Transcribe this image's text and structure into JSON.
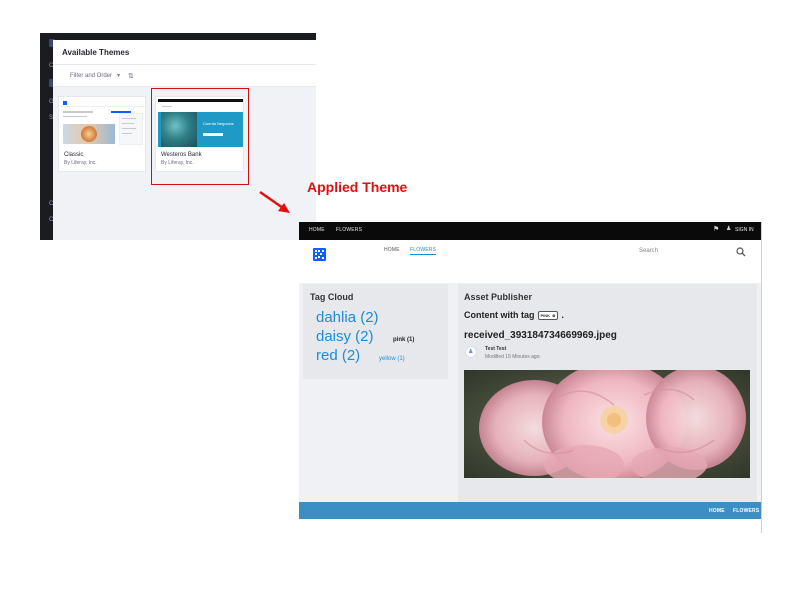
{
  "themes_panel": {
    "title": "Available Themes",
    "filter_label": "Filter and Order",
    "left_glyphs": [
      "C",
      "G",
      "S",
      "C",
      "C"
    ],
    "cards": [
      {
        "name": "Classic",
        "author": "By Liferay, Inc."
      },
      {
        "name": "Westeros Bank",
        "author": "By Liferay, Inc.",
        "preview_text": "Cuenta Negocios"
      }
    ]
  },
  "annotation": {
    "label": "Applied Theme",
    "color": "#e01010"
  },
  "site": {
    "topbar": {
      "home": "HOME",
      "flowers": "FLOWERS",
      "sign_in": "SIGN IN"
    },
    "nav": {
      "home": "HOME",
      "flowers": "FLOWERS"
    },
    "search_placeholder": "Search",
    "tag_cloud": {
      "title": "Tag Cloud",
      "tags": [
        {
          "label": "dahlia (2)"
        },
        {
          "label": "daisy (2)"
        },
        {
          "label": "red (2)"
        },
        {
          "label": "pink (1)"
        },
        {
          "label": "yellow (1)"
        }
      ]
    },
    "asset_publisher": {
      "title": "Asset Publisher",
      "content_with_tag": "Content with tag",
      "tag_pill": "PINK",
      "tag_pill_suffix": ".",
      "filename": "received_393184734669969.jpeg",
      "author": "Test Test",
      "modified": "Modified 15 Minutes ago."
    },
    "footer": {
      "home": "HOME",
      "flowers": "FLOWERS"
    },
    "colors": {
      "accent": "#1b8cd8",
      "footer": "#3b8fc2",
      "logo": "#0b5fff"
    }
  }
}
